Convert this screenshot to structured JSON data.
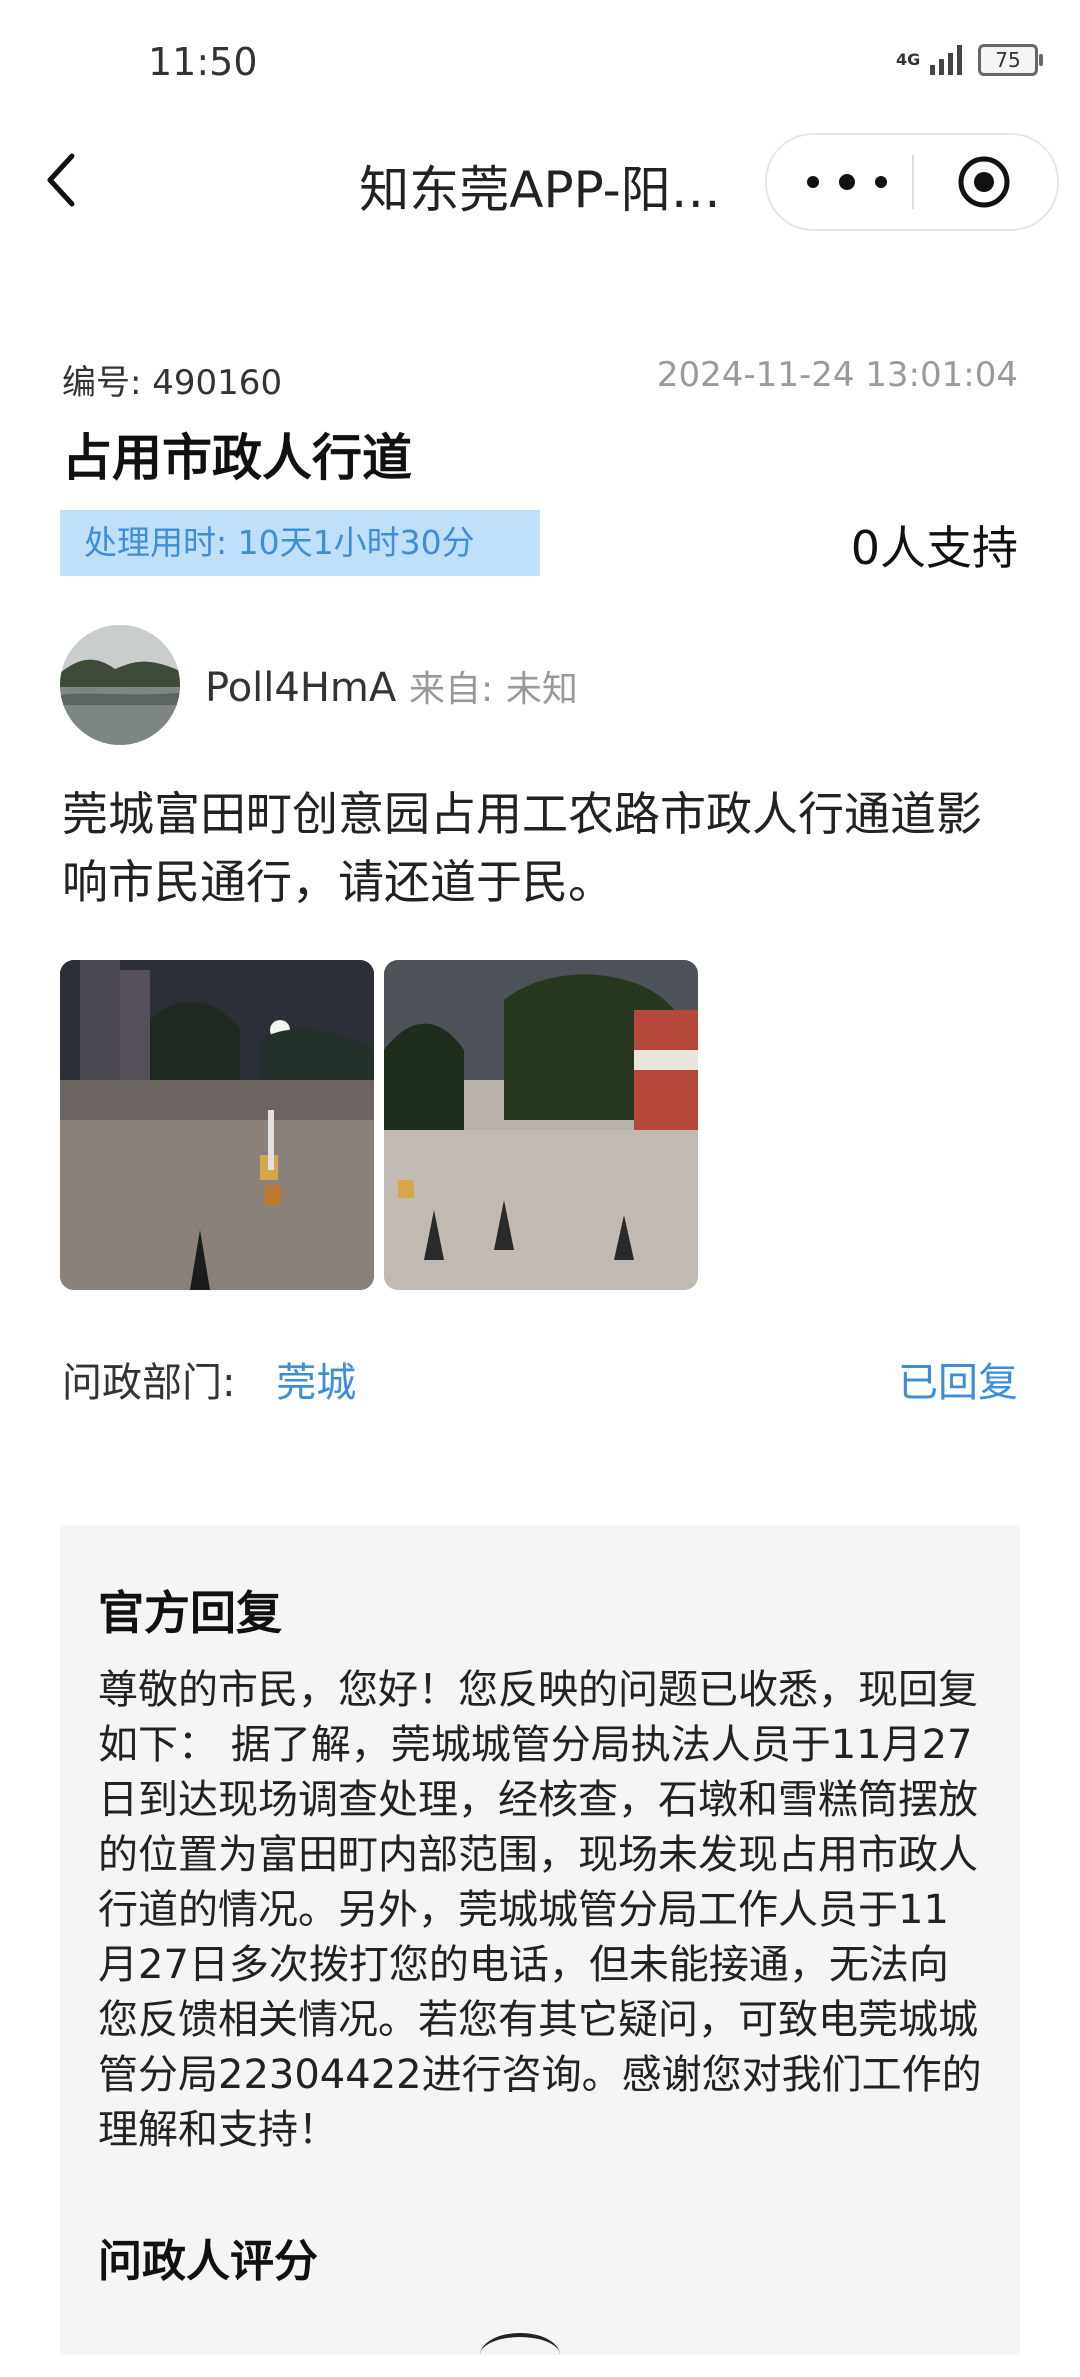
{
  "status_bar": {
    "time": "11:50",
    "network": "4G",
    "battery": "75",
    "icons": [
      "signal-icon",
      "battery-icon"
    ]
  },
  "nav": {
    "title": "知东莞APP-阳…",
    "icons": [
      "back-icon",
      "more-icon",
      "record-icon"
    ]
  },
  "issue": {
    "number_label": "编号:",
    "number": "490160",
    "date": "2024-11-24 13:01:04",
    "title": "占用市政人行道",
    "time_used_label": "处理用时:",
    "time_used": "10天1小时30分",
    "support": "0人支持"
  },
  "user": {
    "name": "Poll4HmA",
    "from_label": "来自:",
    "from": "未知"
  },
  "content": "莞城富田町创意园占用工农路市政人行通道影响市民通行，请还道于民。",
  "photos": [
    {
      "name": "photo-street-night-1"
    },
    {
      "name": "photo-street-night-2"
    }
  ],
  "department": {
    "label": "问政部门:",
    "value": "莞城",
    "status": "已回复"
  },
  "reply": {
    "heading": "官方回复",
    "body": "尊敬的市民，您好！您反映的问题已收悉，现回复如下： 据了解，莞城城管分局执法人员于11月27日到达现场调查处理，经核查，石墩和雪糕筒摆放的位置为富田町内部范围，现场未发现占用市政人行道的情况。另外，莞城城管分局工作人员于11月27日多次拨打您的电话，但未能接通，无法向您反馈相关情况。若您有其它疑问，可致电莞城城管分局22304422进行咨询。感谢您对我们工作的理解和支持！",
    "rating_heading": "问政人评分"
  },
  "colors": {
    "accent": "#3b8fd8",
    "badge_bg": "#bfe0fb",
    "card_bg": "#f5f5f5"
  }
}
